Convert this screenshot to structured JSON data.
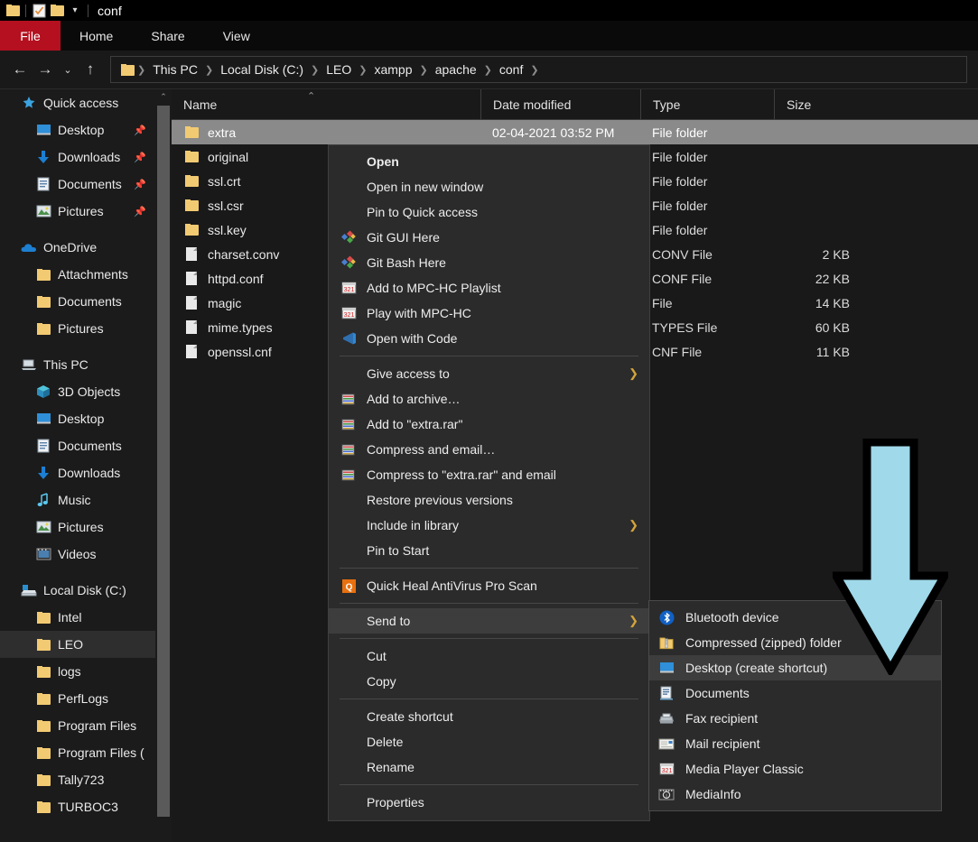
{
  "titlebar": {
    "title": "conf",
    "quick_access_icons": [
      "folder-icon",
      "properties-checklist-icon",
      "folder-icon",
      "chevron-down-icon"
    ]
  },
  "ribbon": {
    "file_tab": "File",
    "file_tab_color": "#b4101f",
    "tabs": [
      "Home",
      "Share",
      "View"
    ]
  },
  "address_bar": {
    "back_icon": "back-arrow-icon",
    "forward_icon": "forward-arrow-icon",
    "recent_icon": "chevron-down-icon",
    "up_icon": "up-arrow-icon",
    "breadcrumbs": [
      "This PC",
      "Local Disk (C:)",
      "LEO",
      "xampp",
      "apache",
      "conf"
    ]
  },
  "sidebar": {
    "groups": [
      {
        "header": {
          "label": "Quick access",
          "icon": "star-icon"
        },
        "items": [
          {
            "label": "Desktop",
            "icon": "monitor-icon",
            "pinned": true
          },
          {
            "label": "Downloads",
            "icon": "download-arrow-icon",
            "pinned": true
          },
          {
            "label": "Documents",
            "icon": "document-icon",
            "pinned": true
          },
          {
            "label": "Pictures",
            "icon": "picture-icon",
            "pinned": true
          }
        ]
      },
      {
        "header": {
          "label": "OneDrive",
          "icon": "cloud-icon"
        },
        "items": [
          {
            "label": "Attachments",
            "icon": "folder-icon",
            "pinned": false
          },
          {
            "label": "Documents",
            "icon": "folder-icon",
            "pinned": false
          },
          {
            "label": "Pictures",
            "icon": "folder-icon",
            "pinned": false
          }
        ]
      },
      {
        "header": {
          "label": "This PC",
          "icon": "computer-icon"
        },
        "items": [
          {
            "label": "3D Objects",
            "icon": "cube-icon",
            "pinned": false
          },
          {
            "label": "Desktop",
            "icon": "monitor-icon",
            "pinned": false
          },
          {
            "label": "Documents",
            "icon": "document-icon",
            "pinned": false
          },
          {
            "label": "Downloads",
            "icon": "download-arrow-icon",
            "pinned": false
          },
          {
            "label": "Music",
            "icon": "music-note-icon",
            "pinned": false
          },
          {
            "label": "Pictures",
            "icon": "picture-icon",
            "pinned": false
          },
          {
            "label": "Videos",
            "icon": "video-icon",
            "pinned": false
          }
        ]
      },
      {
        "header": {
          "label": "Local Disk (C:)",
          "icon": "drive-icon"
        },
        "items": [
          {
            "label": "Intel",
            "icon": "folder-icon",
            "pinned": false
          },
          {
            "label": "LEO",
            "icon": "folder-icon",
            "pinned": false,
            "selected": true
          },
          {
            "label": "logs",
            "icon": "folder-icon",
            "pinned": false
          },
          {
            "label": "PerfLogs",
            "icon": "folder-icon",
            "pinned": false
          },
          {
            "label": "Program Files",
            "icon": "folder-icon",
            "pinned": false
          },
          {
            "label": "Program Files (",
            "icon": "folder-icon",
            "pinned": false
          },
          {
            "label": "Tally723",
            "icon": "folder-icon",
            "pinned": false
          },
          {
            "label": "TURBOC3",
            "icon": "folder-icon",
            "pinned": false
          }
        ]
      }
    ]
  },
  "file_list": {
    "columns": [
      "Name",
      "Date modified",
      "Type",
      "Size"
    ],
    "sort_indicator": "ascending",
    "rows": [
      {
        "name": "extra",
        "date": "02-04-2021 03:52 PM",
        "type": "File folder",
        "size": "",
        "icon": "folder-icon",
        "selected": true
      },
      {
        "name": "original",
        "date": "",
        "type": "File folder",
        "size": "",
        "icon": "folder-icon",
        "selected": false
      },
      {
        "name": "ssl.crt",
        "date": "",
        "type": "File folder",
        "size": "",
        "icon": "folder-icon",
        "selected": false
      },
      {
        "name": "ssl.csr",
        "date": "",
        "type": "File folder",
        "size": "",
        "icon": "folder-icon",
        "selected": false
      },
      {
        "name": "ssl.key",
        "date": "",
        "type": "File folder",
        "size": "",
        "icon": "folder-icon",
        "selected": false
      },
      {
        "name": "charset.conv",
        "date": "",
        "type": "CONV File",
        "size": "2 KB",
        "icon": "file-icon",
        "selected": false
      },
      {
        "name": "httpd.conf",
        "date": "",
        "type": "CONF File",
        "size": "22 KB",
        "icon": "file-icon",
        "selected": false
      },
      {
        "name": "magic",
        "date": "",
        "type": "File",
        "size": "14 KB",
        "icon": "file-icon",
        "selected": false
      },
      {
        "name": "mime.types",
        "date": "",
        "type": "TYPES File",
        "size": "60 KB",
        "icon": "file-icon",
        "selected": false
      },
      {
        "name": "openssl.cnf",
        "date": "",
        "type": "CNF File",
        "size": "11 KB",
        "icon": "file-icon",
        "selected": false
      }
    ]
  },
  "context_menu": {
    "items": [
      {
        "label": "Open",
        "bold": true,
        "icon": "",
        "arrow": false,
        "highlighted": false
      },
      {
        "label": "Open in new window",
        "bold": false,
        "icon": "",
        "arrow": false,
        "highlighted": false
      },
      {
        "label": "Pin to Quick access",
        "bold": false,
        "icon": "",
        "arrow": false,
        "highlighted": false
      },
      {
        "label": "Git GUI Here",
        "bold": false,
        "icon": "git-icon",
        "arrow": false,
        "highlighted": false
      },
      {
        "label": "Git Bash Here",
        "bold": false,
        "icon": "git-icon",
        "arrow": false,
        "highlighted": false
      },
      {
        "label": "Add to MPC-HC Playlist",
        "bold": false,
        "icon": "mpc-hc-icon",
        "arrow": false,
        "highlighted": false
      },
      {
        "label": "Play with MPC-HC",
        "bold": false,
        "icon": "mpc-hc-icon",
        "arrow": false,
        "highlighted": false
      },
      {
        "label": "Open with Code",
        "bold": false,
        "icon": "vscode-icon",
        "arrow": false,
        "highlighted": false
      },
      {
        "separator": true
      },
      {
        "label": "Give access to",
        "bold": false,
        "icon": "",
        "arrow": true,
        "highlighted": false
      },
      {
        "label": "Add to archive…",
        "bold": false,
        "icon": "winrar-icon",
        "arrow": false,
        "highlighted": false
      },
      {
        "label": "Add to \"extra.rar\"",
        "bold": false,
        "icon": "winrar-icon",
        "arrow": false,
        "highlighted": false
      },
      {
        "label": "Compress and email…",
        "bold": false,
        "icon": "winrar-icon",
        "arrow": false,
        "highlighted": false
      },
      {
        "label": "Compress to \"extra.rar\" and email",
        "bold": false,
        "icon": "winrar-icon",
        "arrow": false,
        "highlighted": false
      },
      {
        "label": "Restore previous versions",
        "bold": false,
        "icon": "",
        "arrow": false,
        "highlighted": false
      },
      {
        "label": "Include in library",
        "bold": false,
        "icon": "",
        "arrow": true,
        "highlighted": false
      },
      {
        "label": "Pin to Start",
        "bold": false,
        "icon": "",
        "arrow": false,
        "highlighted": false
      },
      {
        "separator": true
      },
      {
        "label": "Quick Heal AntiVirus Pro Scan",
        "bold": false,
        "icon": "quickheal-icon",
        "arrow": false,
        "highlighted": false
      },
      {
        "separator": true
      },
      {
        "label": "Send to",
        "bold": false,
        "icon": "",
        "arrow": true,
        "highlighted": true
      },
      {
        "separator": true
      },
      {
        "label": "Cut",
        "bold": false,
        "icon": "",
        "arrow": false,
        "highlighted": false
      },
      {
        "label": "Copy",
        "bold": false,
        "icon": "",
        "arrow": false,
        "highlighted": false
      },
      {
        "separator": true
      },
      {
        "label": "Create shortcut",
        "bold": false,
        "icon": "",
        "arrow": false,
        "highlighted": false
      },
      {
        "label": "Delete",
        "bold": false,
        "icon": "",
        "arrow": false,
        "highlighted": false
      },
      {
        "label": "Rename",
        "bold": false,
        "icon": "",
        "arrow": false,
        "highlighted": false
      },
      {
        "separator": true
      },
      {
        "label": "Properties",
        "bold": false,
        "icon": "",
        "arrow": false,
        "highlighted": false
      }
    ]
  },
  "send_to_submenu": {
    "items": [
      {
        "label": "Bluetooth device",
        "icon": "bluetooth-icon",
        "highlighted": false
      },
      {
        "label": "Compressed (zipped) folder",
        "icon": "zipped-folder-icon",
        "highlighted": false
      },
      {
        "label": "Desktop (create shortcut)",
        "icon": "monitor-icon",
        "highlighted": true
      },
      {
        "label": "Documents",
        "icon": "documents-icon",
        "highlighted": false
      },
      {
        "label": "Fax recipient",
        "icon": "fax-icon",
        "highlighted": false
      },
      {
        "label": "Mail recipient",
        "icon": "mail-icon",
        "highlighted": false
      },
      {
        "label": "Media Player Classic",
        "icon": "mpc-hc-icon",
        "highlighted": false
      },
      {
        "label": "MediaInfo",
        "icon": "mediainfo-icon",
        "highlighted": false
      }
    ]
  },
  "annotation": {
    "arrow_icon": "down-arrow-annotation",
    "fill_color": "#9fd9ea",
    "outline_color": "#000000"
  }
}
